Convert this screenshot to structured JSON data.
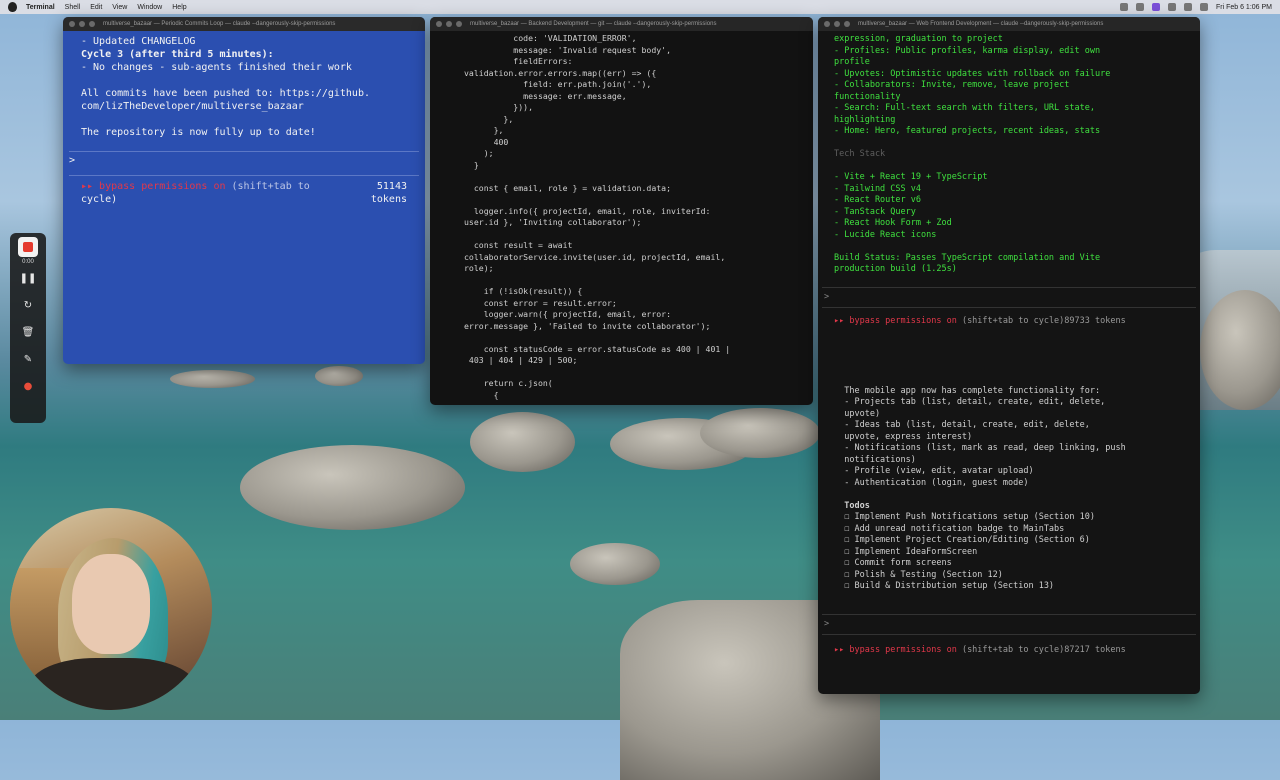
{
  "menubar": {
    "app": "Terminal",
    "items": [
      "Shell",
      "Edit",
      "View",
      "Window",
      "Help"
    ],
    "clock": "Fri Feb 6  1:06 PM"
  },
  "recorder": {
    "time": "0:00"
  },
  "left_window": {
    "title": "multiverse_bazaar — Periodic Commits Loop — claude --dangerously-skip-permissions",
    "lines": [
      "- Updated CHANGELOG",
      "",
      "Cycle 3 (after third 5 minutes):",
      "- No changes - sub-agents finished their work",
      "",
      "All commits have been pushed to: https://github.",
      "com/lizTheDeveloper/multiverse_bazaar",
      "",
      "The repository is now fully up to date!"
    ],
    "prompt": ">",
    "status_a": "▸▸ bypass permissions on",
    "status_b": " (shift+tab to",
    "status_c": "cycle)",
    "tokens_value": "51143",
    "tokens_unit": "tokens"
  },
  "middle_window": {
    "title": "multiverse_bazaar — Backend Development — git — claude --dangerously-skip-permissions",
    "code": [
      "          code: 'VALIDATION_ERROR',",
      "          message: 'Invalid request body',",
      "          fieldErrors:",
      "validation.error.errors.map((err) => ({",
      "            field: err.path.join('.'),",
      "            message: err.message,",
      "          })),",
      "        },",
      "      },",
      "      400",
      "    );",
      "  }",
      "",
      "  const { email, role } = validation.data;",
      "",
      "  logger.info({ projectId, email, role, inviterId:",
      "user.id }, 'Inviting collaborator');",
      "",
      "  const result = await",
      "collaboratorService.invite(user.id, projectId, email,",
      "role);",
      "",
      "    if (!isOk(result)) {",
      "    const error = result.error;",
      "    logger.warn({ projectId, email, error:",
      "error.message }, 'Failed to invite collaborator');",
      "",
      "    const statusCode = error.statusCode as 400 | 401 |",
      " 403 | 404 | 429 | 500;",
      "",
      "    return c.json(",
      "      {"
    ]
  },
  "right_window": {
    "title": "multiverse_bazaar — Web Frontend Development — claude --dangerously-skip-permissions",
    "top_lines": [
      {
        "t": "expression, graduation to project",
        "s": ""
      },
      {
        "t": "- Profiles: Public profiles, karma display, edit own",
        "s": ""
      },
      {
        "t": "profile",
        "s": ""
      },
      {
        "t": "- Upvotes: Optimistic updates with rollback on failure",
        "s": ""
      },
      {
        "t": "- Collaborators: Invite, remove, leave project",
        "s": ""
      },
      {
        "t": "functionality",
        "s": ""
      },
      {
        "t": "- Search: Full-text search with filters, URL state,",
        "s": ""
      },
      {
        "t": "highlighting",
        "s": ""
      },
      {
        "t": "- Home: Hero, featured projects, recent ideas, stats",
        "s": ""
      },
      {
        "t": "",
        "s": ""
      },
      {
        "t": "Tech Stack",
        "s": "dim"
      },
      {
        "t": "",
        "s": ""
      },
      {
        "t": "- Vite + React 19 + TypeScript",
        "s": ""
      },
      {
        "t": "- Tailwind CSS v4",
        "s": ""
      },
      {
        "t": "- React Router v6",
        "s": ""
      },
      {
        "t": "- TanStack Query",
        "s": ""
      },
      {
        "t": "- React Hook Form + Zod",
        "s": ""
      },
      {
        "t": "- Lucide React icons",
        "s": ""
      },
      {
        "t": "",
        "s": ""
      },
      {
        "t": "Build Status: Passes TypeScript compilation and Vite",
        "s": ""
      },
      {
        "t": "production build (1.25s)",
        "s": ""
      }
    ],
    "prompt_top": ">",
    "status_top": "▸▸ bypass permissions on",
    "status_top_rest": " (shift+tab to cycle)89733 tokens",
    "bottom_lines": [
      {
        "t": "  The mobile app now has complete functionality for:",
        "s": ""
      },
      {
        "t": "  - Projects tab (list, detail, create, edit, delete,",
        "s": ""
      },
      {
        "t": "  upvote)",
        "s": ""
      },
      {
        "t": "  - Ideas tab (list, detail, create, edit, delete,",
        "s": ""
      },
      {
        "t": "  upvote, express interest)",
        "s": ""
      },
      {
        "t": "  - Notifications (list, mark as read, deep linking, push",
        "s": ""
      },
      {
        "t": "  notifications)",
        "s": ""
      },
      {
        "t": "  - Profile (view, edit, avatar upload)",
        "s": ""
      },
      {
        "t": "  - Authentication (login, guest mode)",
        "s": ""
      },
      {
        "t": "",
        "s": ""
      },
      {
        "t": "  Todos",
        "s": "bold"
      },
      {
        "t": "  ☐ Implement Push Notifications setup (Section 10)",
        "s": ""
      },
      {
        "t": "  ☐ Add unread notification badge to MainTabs",
        "s": ""
      },
      {
        "t": "  ☐ Implement Project Creation/Editing (Section 6)",
        "s": ""
      },
      {
        "t": "  ☐ Implement IdeaFormScreen",
        "s": ""
      },
      {
        "t": "  ☐ Commit form screens",
        "s": ""
      },
      {
        "t": "  ☐ Polish & Testing (Section 12)",
        "s": ""
      },
      {
        "t": "  ☐ Build & Distribution setup (Section 13)",
        "s": ""
      }
    ],
    "prompt_bottom": ">",
    "status_bottom": "▸▸ bypass permissions on",
    "status_bottom_rest": " (shift+tab to cycle)87217 tokens"
  }
}
